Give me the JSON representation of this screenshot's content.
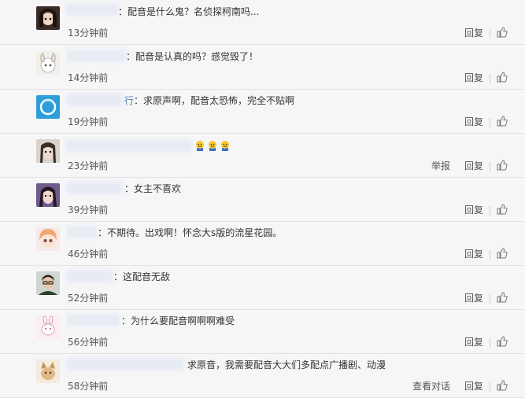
{
  "comments": [
    {
      "text": "：配音是什么鬼？名侦探柯南吗...",
      "time": "13分钟前",
      "report": "",
      "reply": "回复"
    },
    {
      "text": "：配音是认真的吗？感觉毁了！",
      "time": "14分钟前",
      "report": "",
      "reply": "回复"
    },
    {
      "name_suffix": "行",
      "text": "：求原声啊，配音太恐怖，完全不贴啊",
      "time": "19分钟前",
      "report": "",
      "reply": "回复"
    },
    {
      "text": "",
      "time": "23分钟前",
      "report": "举报",
      "reply": "回复"
    },
    {
      "text": "：女主不喜欢",
      "time": "39分钟前",
      "report": "",
      "reply": "回复"
    },
    {
      "text": "：不期待。出戏啊！怀念大s版的流星花园。",
      "time": "46分钟前",
      "report": "",
      "reply": "回复"
    },
    {
      "text": "：这配音无敌",
      "time": "52分钟前",
      "report": "",
      "reply": "回复"
    },
    {
      "text": "：为什么要配音啊啊啊难受",
      "time": "56分钟前",
      "report": "",
      "reply": "回复"
    },
    {
      "text": "求原音，我需要配音大大们多配点广播剧、动漫",
      "time": "58分钟前",
      "report": "查看对话",
      "reply": "回复"
    }
  ]
}
